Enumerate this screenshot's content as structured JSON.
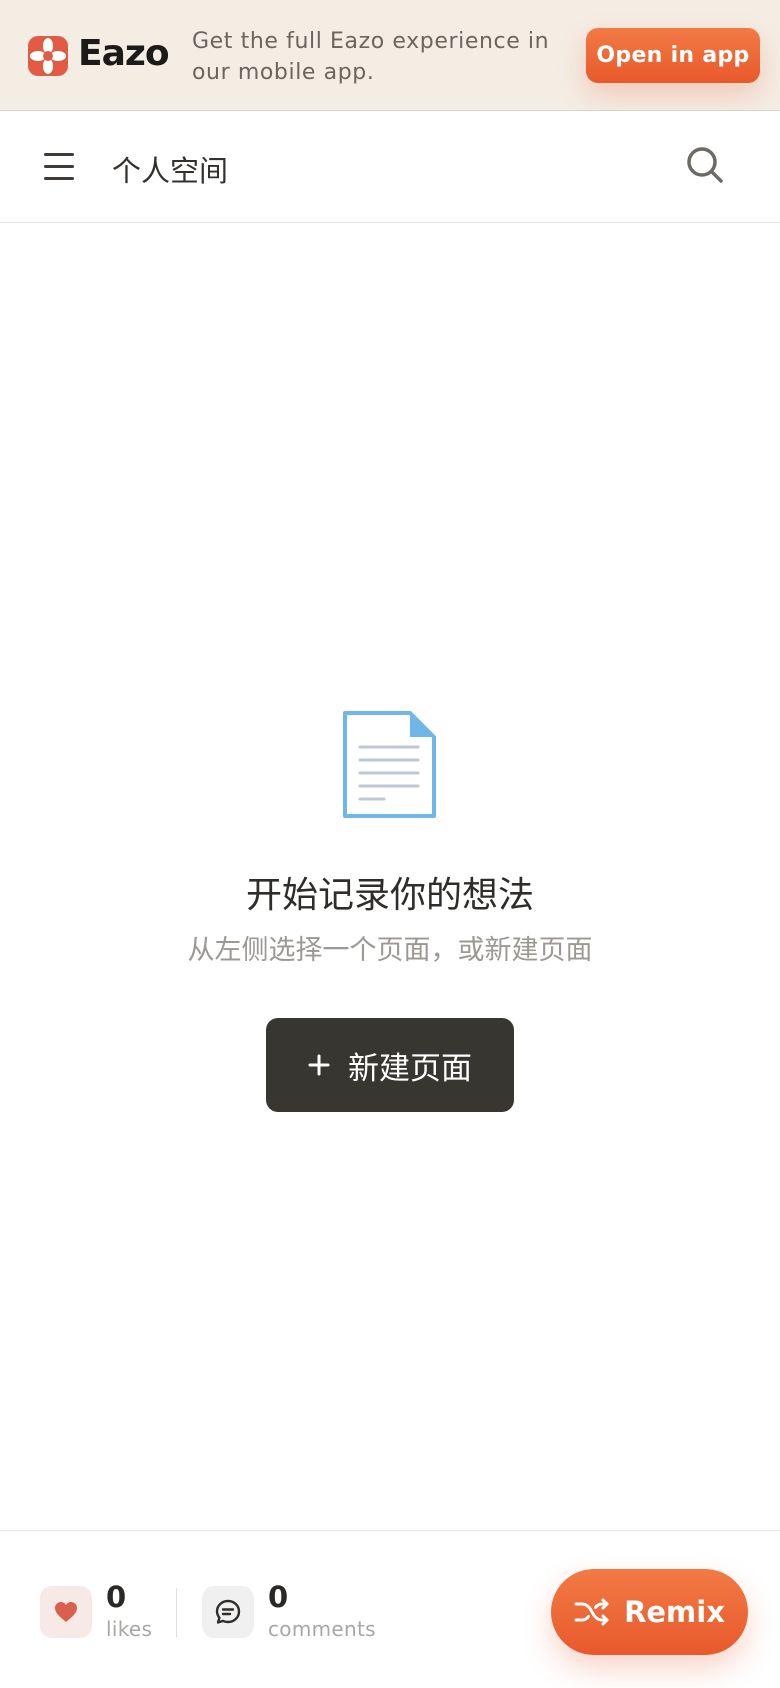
{
  "banner": {
    "brand_name": "Eazo",
    "message": "Get the full Eazo experience in our mobile app.",
    "open_app_label": "Open in app"
  },
  "topbar": {
    "title": "个人空间"
  },
  "empty_state": {
    "title": "开始记录你的想法",
    "subtitle": "从左侧选择一个页面，或新建页面",
    "new_page_label": "新建页面"
  },
  "footer": {
    "likes_count": "0",
    "likes_label": "likes",
    "comments_count": "0",
    "comments_label": "comments",
    "remix_label": "Remix"
  },
  "colors": {
    "accent": "#e8592c",
    "brand_mark": "#e15c45",
    "banner_bg": "#f4ede4",
    "button_dark": "#383631",
    "document_icon": "#6fb7e8"
  },
  "icons": {
    "brand": "brand-flower-icon",
    "menu": "menu-icon",
    "search": "search-icon",
    "document": "document-icon",
    "plus": "plus-icon",
    "heart": "heart-icon",
    "comment": "comment-icon",
    "shuffle": "shuffle-icon"
  }
}
